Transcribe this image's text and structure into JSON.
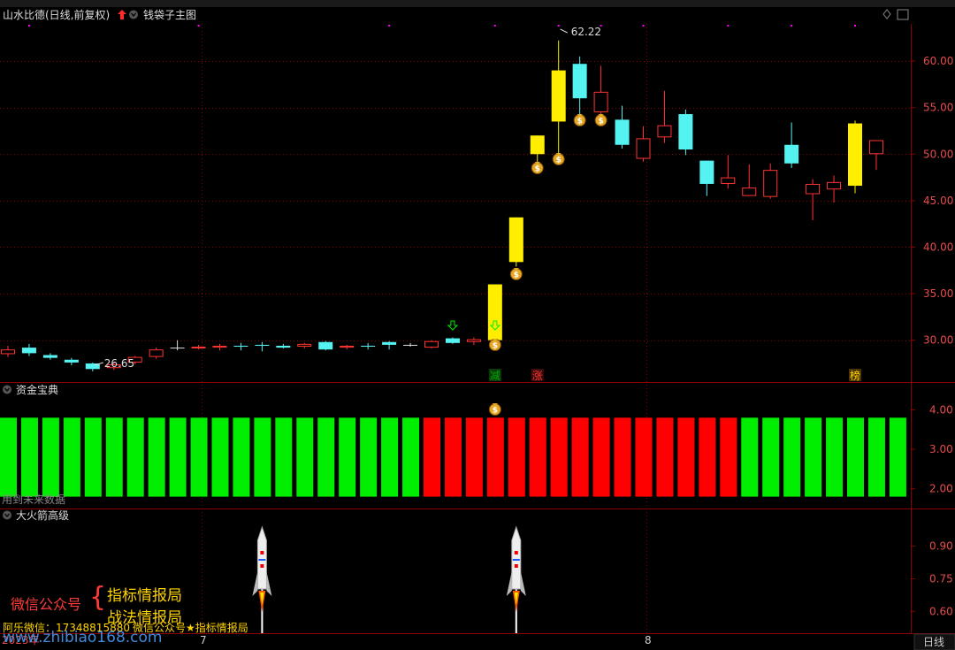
{
  "header": {
    "stock_title": "山水比德(日线,前复权)",
    "indicator_title": "钱袋子主图",
    "chevron_icon": "chevron-down-icon",
    "up_arrow_icon": "red-up-arrow-icon",
    "diamond_icon": "diamond-icon",
    "window_icon": "window-icon"
  },
  "colors": {
    "up_candle": "#ff3333",
    "down_candle": "#55f2f2",
    "yellow_candle": "#ffee00",
    "grid": "#8b0000",
    "green_bar": "#00ee00",
    "red_bar": "#ff0000",
    "axis_text": "#e64b4b",
    "magenta_dots": "#ff00ff"
  },
  "annotations": {
    "high": "62.22",
    "low": "26.65",
    "markers": [
      "减",
      "涨",
      "榜"
    ]
  },
  "panels": {
    "fund": {
      "title": "资金宝典",
      "note": "用到未来数据"
    },
    "rocket": {
      "title": "大火箭高级"
    }
  },
  "axis": {
    "price_ticks": [
      "60.00",
      "55.00",
      "50.00",
      "45.00",
      "40.00",
      "35.00",
      "30.00"
    ],
    "fund_ticks": [
      "4.00",
      "3.00",
      "2.00"
    ],
    "rocket_ticks": [
      "0.90",
      "0.75",
      "0.60"
    ],
    "x_labels": [
      "2023年",
      "7",
      "8"
    ],
    "period_tab": "日线"
  },
  "watermark": {
    "wechat_label": "微信公众号",
    "bracket": "{",
    "line1": "指标情报局",
    "line2": "战法情报局",
    "contact": "阿乐微信：17348815880",
    "contact2": "微信公众号★指标情报局",
    "site": "www.zhibiao168.com"
  },
  "chart_data": [
    {
      "type": "candlestick",
      "title": "钱袋子主图",
      "ylim": [
        25.5,
        64.0
      ],
      "candles": [
        {
          "o": 28.5,
          "h": 29.4,
          "l": 28.2,
          "c": 29.0,
          "col": "up"
        },
        {
          "o": 29.2,
          "h": 29.6,
          "l": 28.3,
          "c": 28.6,
          "col": "down"
        },
        {
          "o": 28.4,
          "h": 28.6,
          "l": 27.9,
          "c": 28.1,
          "col": "down"
        },
        {
          "o": 27.9,
          "h": 28.1,
          "l": 27.3,
          "c": 27.6,
          "col": "down"
        },
        {
          "o": 27.5,
          "h": 27.6,
          "l": 26.65,
          "c": 26.9,
          "col": "down"
        },
        {
          "o": 27.0,
          "h": 27.6,
          "l": 26.8,
          "c": 27.4,
          "col": "up"
        },
        {
          "o": 27.6,
          "h": 28.3,
          "l": 27.4,
          "c": 28.2,
          "col": "up"
        },
        {
          "o": 28.2,
          "h": 29.2,
          "l": 28.0,
          "c": 29.0,
          "col": "up"
        },
        {
          "o": 29.2,
          "h": 30.0,
          "l": 28.9,
          "c": 29.2,
          "col": "flat"
        },
        {
          "o": 29.2,
          "h": 29.5,
          "l": 29.0,
          "c": 29.3,
          "col": "up"
        },
        {
          "o": 29.2,
          "h": 29.6,
          "l": 28.9,
          "c": 29.4,
          "col": "up"
        },
        {
          "o": 29.4,
          "h": 29.7,
          "l": 28.9,
          "c": 29.3,
          "col": "down"
        },
        {
          "o": 29.5,
          "h": 29.8,
          "l": 28.8,
          "c": 29.4,
          "col": "down"
        },
        {
          "o": 29.4,
          "h": 29.6,
          "l": 29.1,
          "c": 29.2,
          "col": "down"
        },
        {
          "o": 29.3,
          "h": 29.7,
          "l": 29.1,
          "c": 29.6,
          "col": "up"
        },
        {
          "o": 29.8,
          "h": 29.9,
          "l": 28.9,
          "c": 29.0,
          "col": "down"
        },
        {
          "o": 29.2,
          "h": 29.5,
          "l": 29.0,
          "c": 29.4,
          "col": "up"
        },
        {
          "o": 29.4,
          "h": 29.7,
          "l": 29.0,
          "c": 29.3,
          "col": "down"
        },
        {
          "o": 29.8,
          "h": 29.9,
          "l": 29.0,
          "c": 29.5,
          "col": "down"
        },
        {
          "o": 29.5,
          "h": 29.7,
          "l": 29.3,
          "c": 29.5,
          "col": "flat"
        },
        {
          "o": 29.2,
          "h": 30.0,
          "l": 29.1,
          "c": 29.9,
          "col": "up"
        },
        {
          "o": 30.2,
          "h": 30.3,
          "l": 29.6,
          "c": 29.7,
          "col": "down"
        },
        {
          "o": 29.8,
          "h": 30.3,
          "l": 29.5,
          "c": 30.1,
          "col": "up"
        },
        {
          "o": 30.0,
          "h": 36.0,
          "l": 30.0,
          "c": 36.0,
          "col": "yellow"
        },
        {
          "o": 38.4,
          "h": 43.2,
          "l": 37.9,
          "c": 43.2,
          "col": "yellow"
        },
        {
          "o": 50.0,
          "h": 52.0,
          "l": 49.0,
          "c": 52.0,
          "col": "yellow"
        },
        {
          "o": 53.5,
          "h": 62.22,
          "l": 50.0,
          "c": 59.0,
          "col": "yellow"
        },
        {
          "o": 59.7,
          "h": 60.5,
          "l": 54.0,
          "c": 56.0,
          "col": "down"
        },
        {
          "o": 54.5,
          "h": 59.5,
          "l": 54.3,
          "c": 56.7,
          "col": "up"
        },
        {
          "o": 53.7,
          "h": 55.2,
          "l": 50.6,
          "c": 51.0,
          "col": "down"
        },
        {
          "o": 49.5,
          "h": 53.0,
          "l": 49.2,
          "c": 51.7,
          "col": "up"
        },
        {
          "o": 51.8,
          "h": 56.8,
          "l": 51.2,
          "c": 53.1,
          "col": "up"
        },
        {
          "o": 54.3,
          "h": 54.8,
          "l": 49.9,
          "c": 50.5,
          "col": "down"
        },
        {
          "o": 49.3,
          "h": 49.3,
          "l": 45.5,
          "c": 46.8,
          "col": "down"
        },
        {
          "o": 46.8,
          "h": 49.9,
          "l": 46.3,
          "c": 47.5,
          "col": "up"
        },
        {
          "o": 46.4,
          "h": 48.9,
          "l": 45.7,
          "c": 45.5,
          "col": "up"
        },
        {
          "o": 45.4,
          "h": 49.0,
          "l": 45.2,
          "c": 48.3,
          "col": "up"
        },
        {
          "o": 51.0,
          "h": 53.4,
          "l": 48.5,
          "c": 49.0,
          "col": "down"
        },
        {
          "o": 45.7,
          "h": 47.3,
          "l": 42.9,
          "c": 46.8,
          "col": "up"
        },
        {
          "o": 46.2,
          "h": 47.7,
          "l": 44.8,
          "c": 47.0,
          "col": "up"
        },
        {
          "o": 46.6,
          "h": 53.6,
          "l": 45.8,
          "c": 53.3,
          "col": "yellow"
        },
        {
          "o": 50.0,
          "h": 51.5,
          "l": 48.3,
          "c": 51.5,
          "col": "up"
        }
      ],
      "bag_markers": [
        23,
        24,
        25,
        26,
        27,
        28
      ],
      "arrow_markers": [
        21,
        23
      ]
    },
    {
      "type": "bar",
      "title": "资金宝典",
      "ylim": [
        1.5,
        4.3
      ],
      "values": [
        3.8,
        3.8,
        3.8,
        3.8,
        3.8,
        3.8,
        3.8,
        3.8,
        3.8,
        3.8,
        3.8,
        3.8,
        3.8,
        3.8,
        3.8,
        3.8,
        3.8,
        3.8,
        3.8,
        3.8,
        3.8,
        3.8,
        3.8,
        3.8,
        3.8,
        3.8,
        3.8,
        3.8,
        3.8,
        3.8,
        3.8,
        3.8,
        3.8,
        3.8,
        3.8,
        3.8,
        3.8,
        3.8,
        3.8,
        3.8,
        3.8,
        3.8,
        3.8
      ],
      "base": 1.8,
      "colors": [
        "green",
        "green",
        "green",
        "green",
        "green",
        "green",
        "green",
        "green",
        "green",
        "green",
        "green",
        "green",
        "green",
        "green",
        "green",
        "green",
        "green",
        "green",
        "green",
        "green",
        "red",
        "red",
        "red",
        "red",
        "red",
        "red",
        "red",
        "red",
        "red",
        "red",
        "red",
        "red",
        "red",
        "red",
        "red",
        "green",
        "green",
        "green",
        "green",
        "green",
        "green",
        "green",
        "green"
      ]
    },
    {
      "type": "event",
      "title": "大火箭高级",
      "ylim": [
        0.5,
        1.0
      ],
      "rocket_indices": [
        12,
        24
      ]
    }
  ]
}
